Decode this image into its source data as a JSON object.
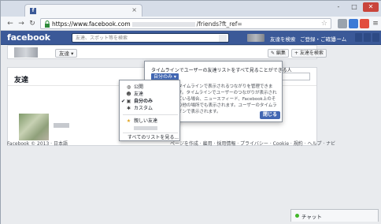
{
  "browser": {
    "tab_title": "",
    "url_host": "https://www.facebook.com",
    "url_path": "/friends?ft_ref=",
    "window_controls": [
      "-",
      "□",
      "✕"
    ]
  },
  "facebook": {
    "logo": "facebook",
    "search_placeholder": "友達、スポット等を検索",
    "nav": {
      "find_friends": "友達を検索",
      "register_profile": "ご登録・ご確認",
      "home": "ホーム"
    }
  },
  "cover": {
    "friend_button": "友達 ▾",
    "edit_button": "✎ 編集",
    "add_friend_button": "+ 友達を検索"
  },
  "friends_panel": {
    "title": "友達"
  },
  "popover": {
    "title": "タイムラインでユーザーの友達リストをすべて見ることができる人",
    "privacy_button": "自分のみ ▾",
    "body": "タイムラインで表示されるつながりを管理できます。タイムラインでユーザーのつながりが表示されている場合、ニュースフィード、Facebook上のその他の場所でも表示されます。ユーザーのタイムラインで表示されます。",
    "close": "閉じる"
  },
  "dropdown": {
    "items": [
      {
        "icon": "globe-icon",
        "label": "公開",
        "selected": false
      },
      {
        "icon": "friends-icon",
        "label": "友達",
        "selected": false
      },
      {
        "icon": "lock-icon",
        "label": "自分のみ",
        "selected": true
      },
      {
        "icon": "gear-icon",
        "label": "カスタム",
        "selected": false
      }
    ],
    "close_friends": "親しい友達",
    "all_lists": "すべてのリストを見る..."
  },
  "footer": {
    "left": "Facebook © 2013 · 日本語",
    "right": "ページを作成 · 雇用 · 採用情報 · プライバシー · Cookie · 規約 · ヘルプ · ナビ"
  },
  "chat": {
    "label": "チャット"
  }
}
